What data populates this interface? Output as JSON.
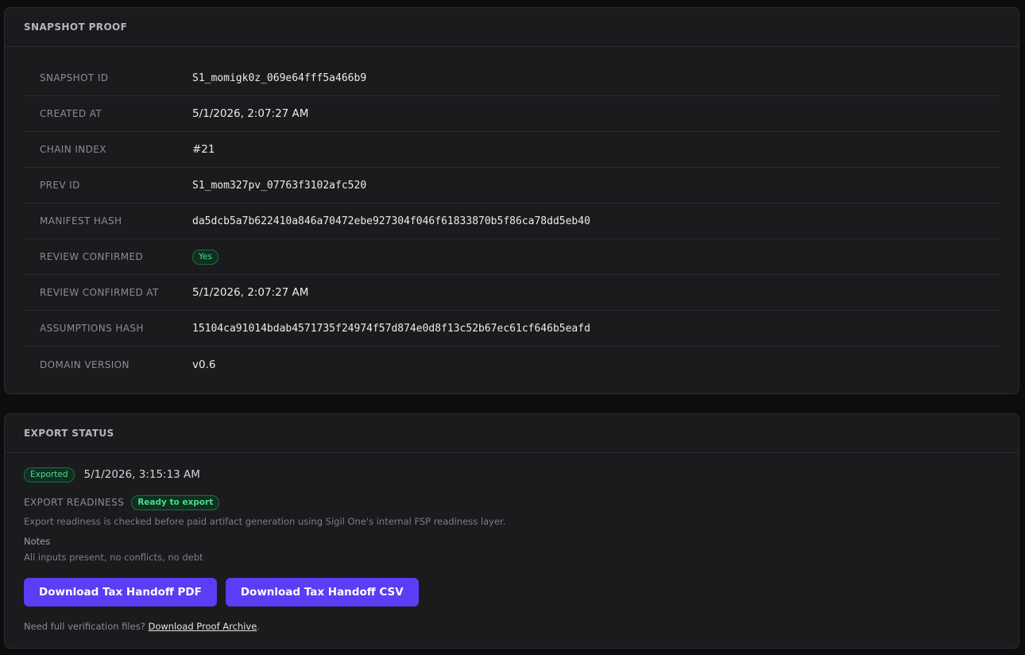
{
  "snapshot_proof": {
    "title": "SNAPSHOT PROOF",
    "rows": [
      {
        "label": "SNAPSHOT ID",
        "value": "S1_momigk0z_069e64fff5a466b9"
      },
      {
        "label": "CREATED AT",
        "value": "5/1/2026, 2:07:27 AM"
      },
      {
        "label": "CHAIN INDEX",
        "value": "#21"
      },
      {
        "label": "PREV ID",
        "value": "S1_mom327pv_07763f3102afc520"
      },
      {
        "label": "MANIFEST HASH",
        "value": "da5dcb5a7b622410a846a70472ebe927304f046f61833870b5f86ca78dd5eb40"
      },
      {
        "label": "REVIEW CONFIRMED",
        "value": "Yes"
      },
      {
        "label": "REVIEW CONFIRMED AT",
        "value": "5/1/2026, 2:07:27 AM"
      },
      {
        "label": "ASSUMPTIONS HASH",
        "value": "15104ca91014bdab4571735f24974f57d874e0d8f13c52b67ec61cf646b5eafd"
      },
      {
        "label": "DOMAIN VERSION",
        "value": "v0.6"
      }
    ]
  },
  "export_status": {
    "title": "EXPORT STATUS",
    "status_badge": "Exported",
    "exported_at": "5/1/2026, 3:15:13 AM",
    "readiness_label": "EXPORT READINESS",
    "readiness_badge": "Ready to export",
    "readiness_description": "Export readiness is checked before paid artifact generation using Sigil One's internal FSP readiness layer.",
    "notes_label": "Notes",
    "notes_value": "All inputs present, no conflicts, no debt",
    "download_pdf_label": "Download Tax Handoff PDF",
    "download_csv_label": "Download Tax Handoff CSV",
    "footer_text": "Need full verification files?",
    "footer_link": "Download Proof Archive",
    "footer_suffix": "."
  },
  "colors": {
    "background": "#0d0d0f",
    "card": "#1b1b1e",
    "accent": "#5b3df5",
    "success": "#4ade80"
  }
}
